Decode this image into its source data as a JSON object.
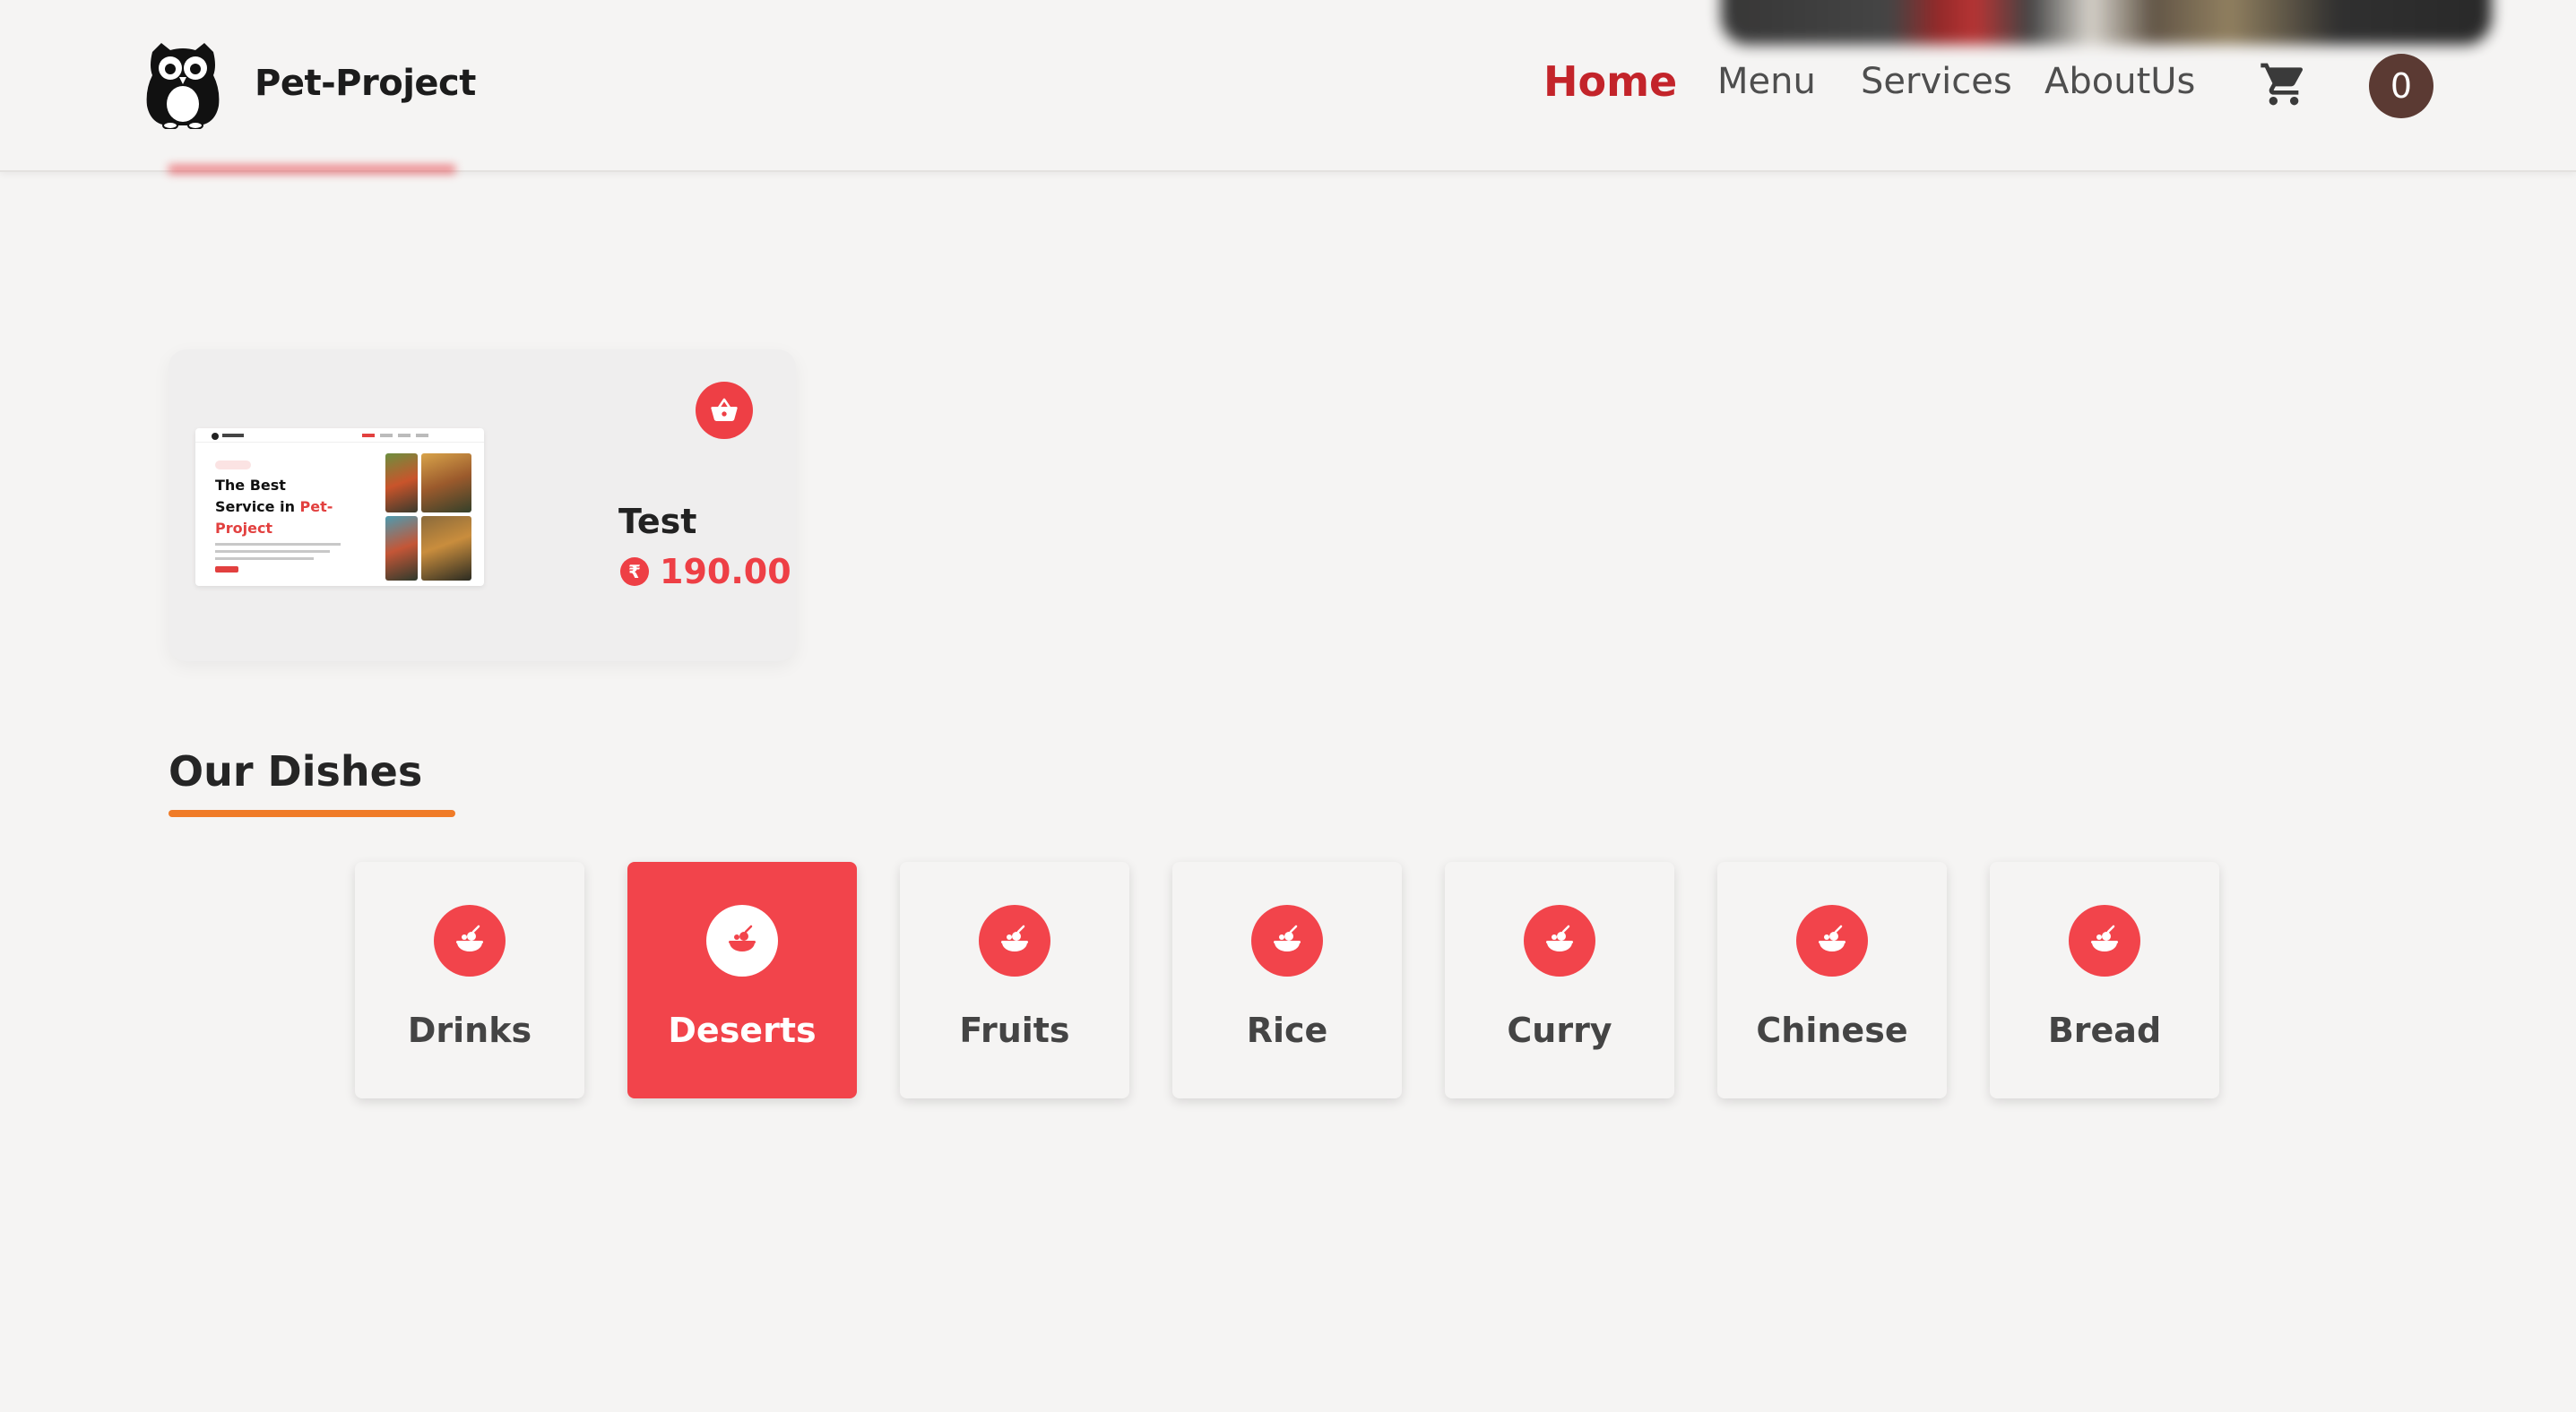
{
  "header": {
    "brand": "Pet-Project",
    "nav": {
      "home": "Home",
      "menu": "Menu",
      "services": "Services",
      "about": "AboutUs"
    },
    "avatar_initial": "0"
  },
  "product": {
    "title": "Test",
    "price": "190.00",
    "currency_symbol": "₹",
    "thumbnail": {
      "headline_prefix": "The Best Service in",
      "headline_highlight": "Pet-Project"
    }
  },
  "section": {
    "title": "Our Dishes"
  },
  "categories": [
    {
      "label": "Drinks",
      "active": false
    },
    {
      "label": "Deserts",
      "active": true
    },
    {
      "label": "Fruits",
      "active": false
    },
    {
      "label": "Rice",
      "active": false
    },
    {
      "label": "Curry",
      "active": false
    },
    {
      "label": "Chinese",
      "active": false
    },
    {
      "label": "Bread",
      "active": false
    }
  ],
  "colors": {
    "accent_red": "#f2444b",
    "home_red": "#c3242a",
    "underline_orange": "#f07b27",
    "avatar_brown": "#5b3a33",
    "background": "#f5f4f3"
  },
  "icons": {
    "logo": "owl-logo-icon",
    "cart": "shopping-cart-icon",
    "basket": "basket-icon",
    "currency": "rupee-icon",
    "category": "food-icon"
  }
}
